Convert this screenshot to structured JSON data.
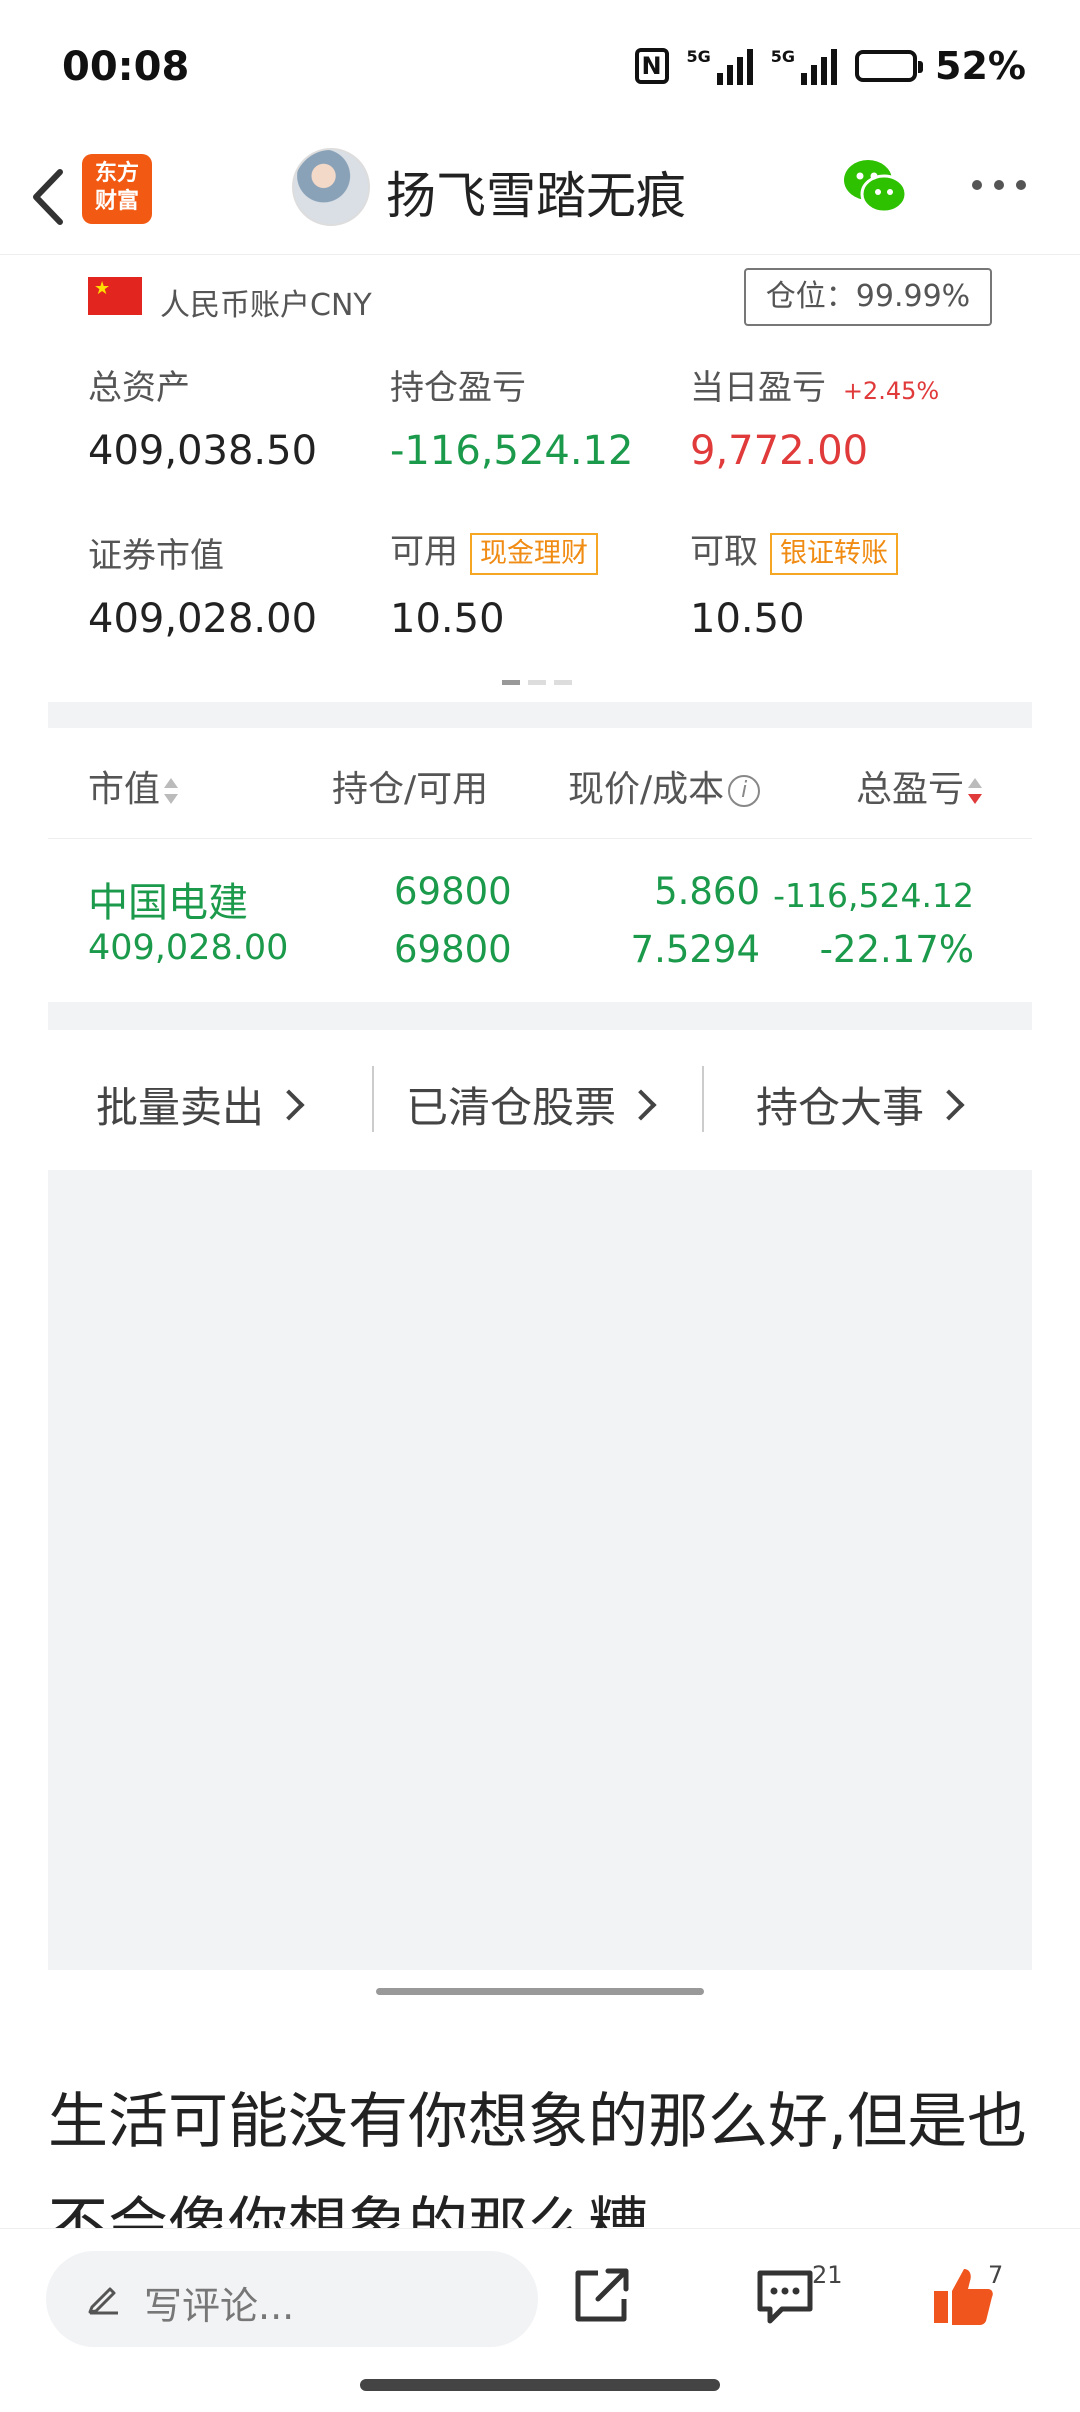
{
  "status_bar": {
    "time": "00:08",
    "battery": "52%",
    "battery_level": 0.52,
    "net1": "5G",
    "net2": "5G"
  },
  "nav": {
    "logo_line1": "东方",
    "logo_line2": "财富",
    "title": "扬飞雪踏无痕"
  },
  "account": {
    "label": "人民币账户CNY",
    "position": "仓位：99.99%",
    "total_assets_label": "总资产",
    "total_assets": "409,038.50",
    "holding_pl_label": "持仓盈亏",
    "holding_pl": "-116,524.12",
    "daily_pl_label": "当日盈亏",
    "daily_pl_pct": "+2.45%",
    "daily_pl": "9,772.00",
    "market_value_label": "证券市值",
    "market_value": "409,028.00",
    "available_label": "可用",
    "available_tag": "现金理财",
    "available": "10.50",
    "withdrawable_label": "可取",
    "withdrawable_tag": "银证转账",
    "withdrawable": "10.50"
  },
  "table": {
    "headers": [
      "市值",
      "持仓/可用",
      "现价/成本",
      "总盈亏"
    ],
    "rows": [
      {
        "name": "中国电建",
        "market_value": "409,028.00",
        "holding": "69800",
        "available": "69800",
        "price": "5.860",
        "cost": "7.5294",
        "total_pl": "-116,524.12",
        "total_pl_pct": "-22.17%"
      }
    ]
  },
  "actions": {
    "batch_sell": "批量卖出",
    "cleared": "已清仓股票",
    "events": "持仓大事"
  },
  "post": {
    "text": "生活可能没有你想象的那么好,但是也不会像你想象的那么糟"
  },
  "footer": {
    "comment_placeholder": "写评论...",
    "comment_count": "21",
    "like_count": "7"
  }
}
